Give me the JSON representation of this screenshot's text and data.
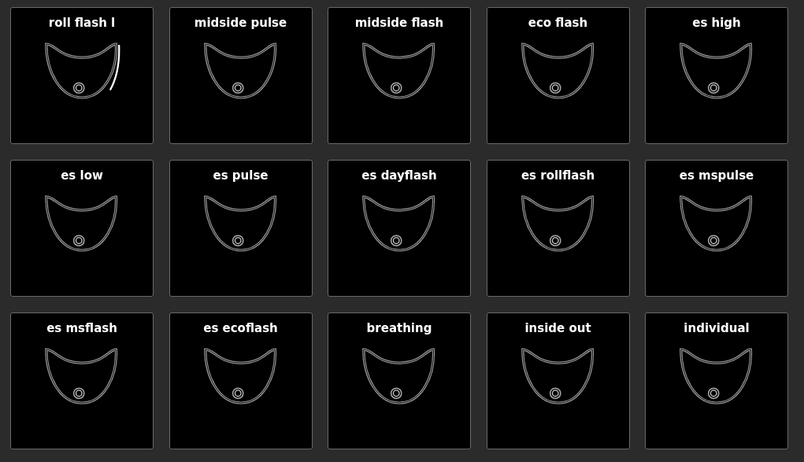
{
  "effects": [
    {
      "label": "roll flash l",
      "lit": true
    },
    {
      "label": "midside pulse",
      "lit": false
    },
    {
      "label": "midside flash",
      "lit": false
    },
    {
      "label": "eco flash",
      "lit": false
    },
    {
      "label": "es high",
      "lit": false
    },
    {
      "label": "es low",
      "lit": false
    },
    {
      "label": "es pulse",
      "lit": false
    },
    {
      "label": "es dayflash",
      "lit": false
    },
    {
      "label": "es rollflash",
      "lit": false
    },
    {
      "label": "es mspulse",
      "lit": false
    },
    {
      "label": "es msflash",
      "lit": false
    },
    {
      "label": "es ecoflash",
      "lit": false
    },
    {
      "label": "breathing",
      "lit": false
    },
    {
      "label": "inside out",
      "lit": false
    },
    {
      "label": "individual",
      "lit": false
    }
  ]
}
